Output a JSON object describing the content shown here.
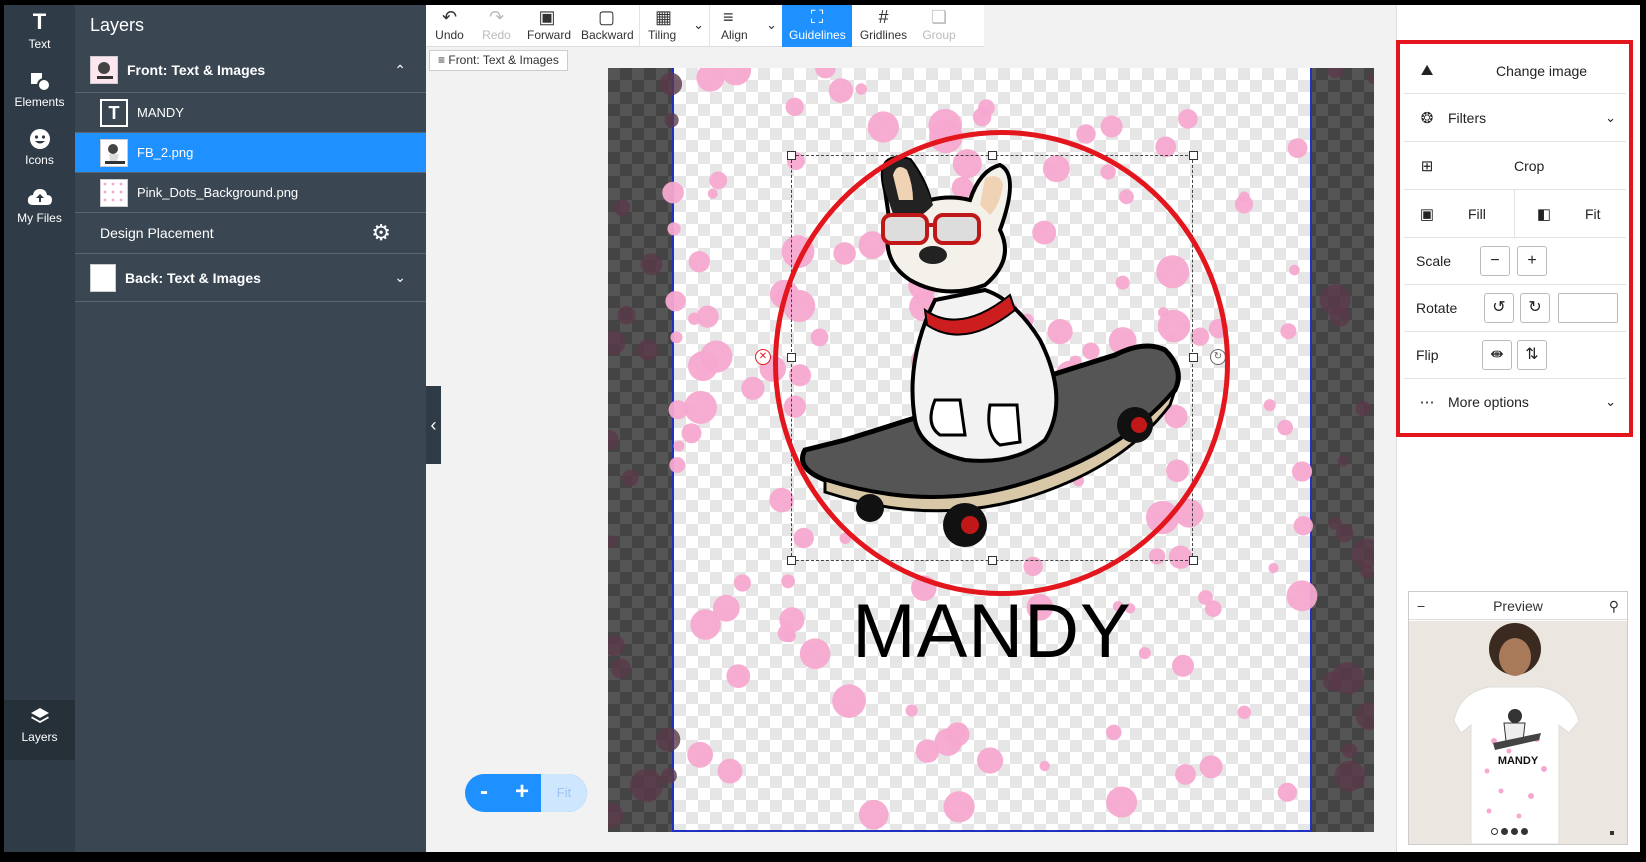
{
  "rail": {
    "items": [
      {
        "label": "Text",
        "icon": "text-icon"
      },
      {
        "label": "Elements",
        "icon": "elements-icon"
      },
      {
        "label": "Icons",
        "icon": "smiley-icon"
      },
      {
        "label": "My Files",
        "icon": "cloud-upload-icon"
      }
    ],
    "layers_label": "Layers"
  },
  "layers": {
    "title": "Layers",
    "front_group": "Front: Text & Images",
    "items": [
      {
        "label": "MANDY"
      },
      {
        "label": "FB_2.png"
      },
      {
        "label": "Pink_Dots_Background.png"
      }
    ],
    "design_placement": "Design Placement",
    "back_group": "Back: Text & Images"
  },
  "toolbar": {
    "undo": "Undo",
    "redo": "Redo",
    "forward": "Forward",
    "backward": "Backward",
    "tiling": "Tiling",
    "align": "Align",
    "guidelines": "Guidelines",
    "gridlines": "Gridlines",
    "group": "Group"
  },
  "breadcrumb": "Front: Text & Images",
  "canvas": {
    "text": "MANDY",
    "accent_red": "#e3161d",
    "dot_color": "#f7a8d0"
  },
  "zoom": {
    "minus": "-",
    "plus": "+",
    "fit": "Fit"
  },
  "panel": {
    "change_image": "Change image",
    "filters": "Filters",
    "crop": "Crop",
    "fill": "Fill",
    "fit": "Fit",
    "scale": "Scale",
    "rotate": "Rotate",
    "flip": "Flip",
    "more_options": "More options"
  },
  "preview": {
    "title": "Preview",
    "shirt_text": "MANDY"
  },
  "colors": {
    "accent": "#1e90ff",
    "rail": "#2f3c47",
    "panel": "#3a4753"
  }
}
